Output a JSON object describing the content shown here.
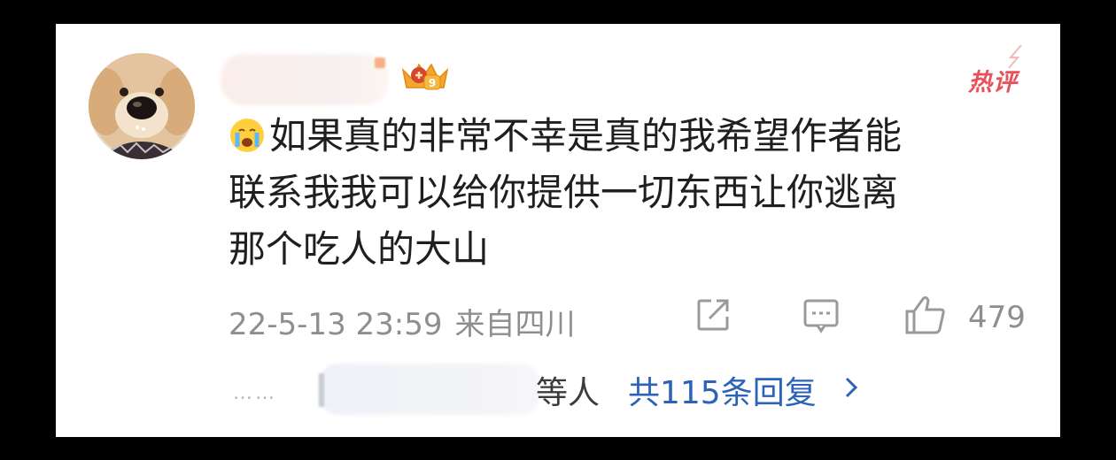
{
  "comment": {
    "text_lines": [
      "如果真的非常不幸是真的我希望作者能",
      "联系我我可以给你提供一切东西让你逃离",
      "那个吃人的大山"
    ],
    "hot_badge": "热评",
    "date": "22-5-13 23:59",
    "location": "来自四川",
    "likes": "479",
    "others_suffix": "等人",
    "replies_link": "共115条回复",
    "dots": "……",
    "icons": {
      "emoji": "crying-face-icon",
      "crown": "crown-badge-icon",
      "share": "share-icon",
      "comment": "comment-icon",
      "like": "thumbs-up-icon",
      "chevron": "chevron-right-icon"
    },
    "colors": {
      "hot": "#e8505a",
      "link": "#2a63b8",
      "meta": "#8e8e8e"
    }
  }
}
